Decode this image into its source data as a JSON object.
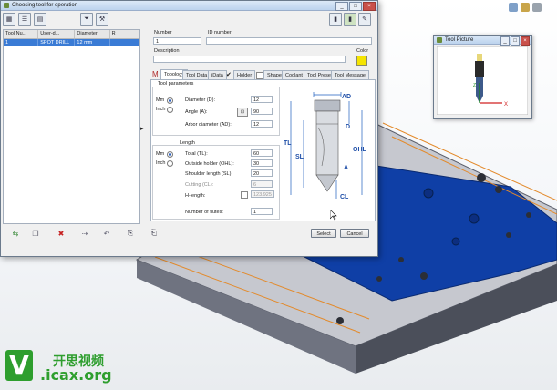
{
  "dialog": {
    "title": "Choosing tool for operation",
    "window_buttons": [
      "_",
      "□",
      "×"
    ]
  },
  "tool_list": {
    "columns": [
      "Tool Nu...",
      "User-d...",
      "Diameter",
      "R"
    ],
    "rows": [
      {
        "tool_number": "1",
        "user_defined": "SPOT DRILL",
        "diameter": "12 mm",
        "r": ""
      }
    ]
  },
  "header_fields": {
    "number_label": "Number",
    "number_value": "1",
    "id_label": "ID number",
    "id_value": "",
    "description_label": "Description",
    "description_value": "",
    "color_label": "Color",
    "color_value": "#f5e400"
  },
  "tabs": [
    {
      "label": "Topology",
      "active": true
    },
    {
      "label": "Tool Data",
      "active": false
    },
    {
      "label": "iData",
      "active": false
    },
    {
      "label": "Holder",
      "active": false
    },
    {
      "label": "Shape",
      "active": false
    },
    {
      "label": "Coolant",
      "active": false
    },
    {
      "label": "Tool Preset",
      "active": false
    },
    {
      "label": "Tool Message",
      "active": false
    }
  ],
  "tool_parameters": {
    "section_title": "Tool parameters",
    "unit_mm": "Mm",
    "unit_inch": "Inch",
    "diameter_label": "Diameter (D):",
    "diameter_value": "12",
    "angle_label": "Angle (A):",
    "angle_value": "90",
    "angle_button": "⊡",
    "arbor_label": "Arbor diameter (AD):",
    "arbor_value": "12"
  },
  "length": {
    "section_title": "Length",
    "unit_mm": "Mm",
    "unit_inch": "Inch",
    "total_label": "Total (TL):",
    "total_value": "60",
    "ohl_label": "Outside holder (OHL):",
    "ohl_value": "30",
    "shoulder_label": "Shoulder length (SL):",
    "shoulder_value": "20",
    "cutting_label": "Cutting (CL):",
    "cutting_value": "6",
    "hlength_label": "H-length:",
    "hlength_value": "123.925",
    "flutes_label": "Number of flutes:",
    "flutes_value": "1"
  },
  "diagram_labels": [
    "AD",
    "D",
    "TL",
    "SL",
    "OHL",
    "A",
    "CL"
  ],
  "buttons": {
    "select": "Select",
    "cancel": "Cancel"
  },
  "tool_picture": {
    "title": "Tool Picture",
    "axis_x": "X",
    "axis_z": "Z"
  },
  "watermark": {
    "logo_letter": "V",
    "site_text": ".icax.org",
    "chinese_text": "开思视频"
  },
  "colors": {
    "accent_blue": "#3a7bd5",
    "part_blue": "#0f3fa6",
    "logo_green": "#2e9e2e"
  }
}
